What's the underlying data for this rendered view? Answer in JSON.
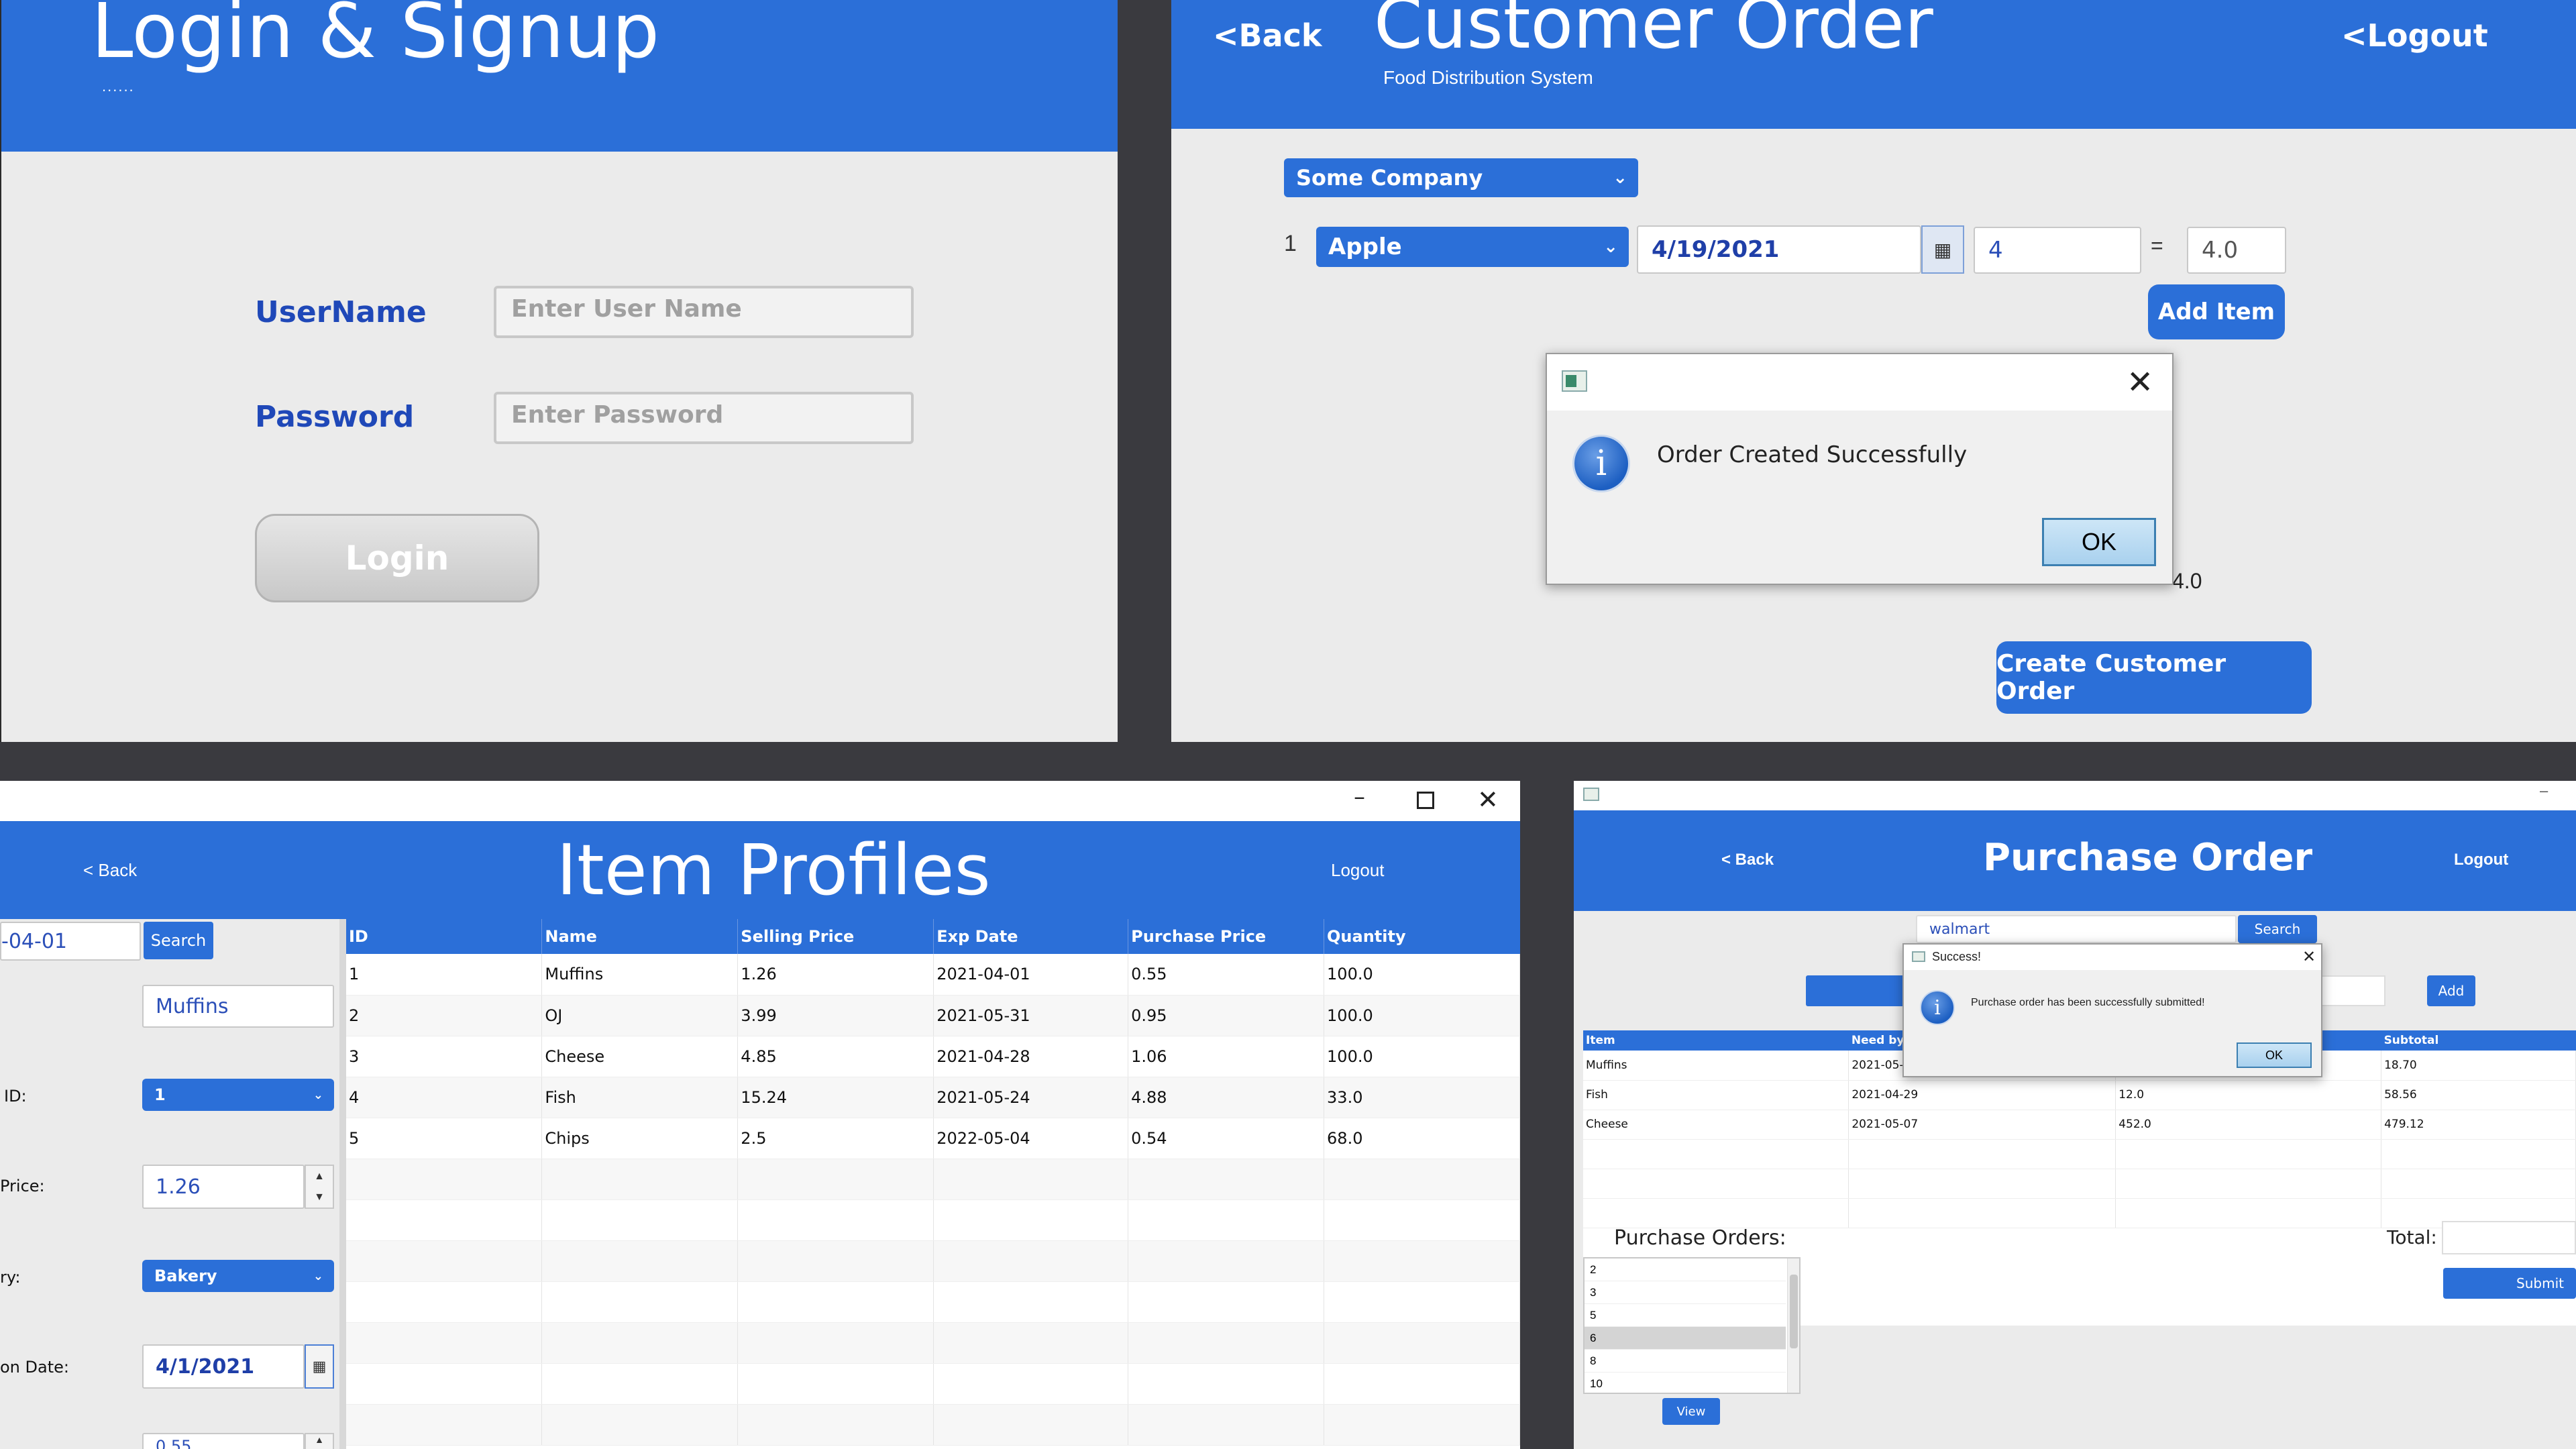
{
  "login": {
    "title": "Login & Signup",
    "subtitle": "......",
    "username_label": "UserName",
    "username_placeholder": "Enter User Name",
    "password_label": "Password",
    "password_placeholder": "Enter Password",
    "login_button": "Login"
  },
  "customer_order": {
    "back": "<Back",
    "title": "Customer Order",
    "subtitle": "Food Distribution System",
    "logout": "<Logout",
    "company_select": "Some Company",
    "row_number": "1",
    "item_select": "Apple",
    "date": "4/19/2021",
    "quantity": "4",
    "equals": "=",
    "line_total": "4.0",
    "add_item": "Add Item",
    "behind_total": "4.0",
    "create_button": "Create Customer Order",
    "dialog": {
      "message": "Order Created Successfully",
      "ok": "OK"
    }
  },
  "item_profiles": {
    "title": "Item Profiles",
    "back": "< Back",
    "logout": "Logout",
    "search_value": "-04-01",
    "search_button": "Search",
    "name_value": "Muffins",
    "id_label": "ID:",
    "id_value": "1",
    "price_label": "Price:",
    "price_value": "1.26",
    "category_label": "ry:",
    "category_value": "Bakery",
    "date_label": "on Date:",
    "date_value": "4/1/2021",
    "bottom_partial": "0.55",
    "columns": [
      "ID",
      "Name",
      "Selling Price",
      "Exp Date",
      "Purchase Price",
      "Quantity"
    ],
    "rows": [
      [
        "1",
        "Muffins",
        "1.26",
        "2021-04-01",
        "0.55",
        "100.0"
      ],
      [
        "2",
        "OJ",
        "3.99",
        "2021-05-31",
        "0.95",
        "100.0"
      ],
      [
        "3",
        "Cheese",
        "4.85",
        "2021-04-28",
        "1.06",
        "100.0"
      ],
      [
        "4",
        "Fish",
        "15.24",
        "2021-05-24",
        "4.88",
        "33.0"
      ],
      [
        "5",
        "Chips",
        "2.5",
        "2022-05-04",
        "0.54",
        "68.0"
      ]
    ]
  },
  "purchase_order": {
    "back": "< Back",
    "title": "Purchase Order",
    "logout": "Logout",
    "search_value": "walmart",
    "search_button": "Search",
    "add_button": "Add",
    "columns": [
      "Item",
      "Need by",
      "",
      "Subtotal"
    ],
    "rows": [
      [
        "Muffins",
        "2021-05-",
        "",
        "18.70"
      ],
      [
        "Fish",
        "2021-04-29",
        "12.0",
        "58.56"
      ],
      [
        "Cheese",
        "2021-05-07",
        "452.0",
        "479.12"
      ]
    ],
    "orders_label": "Purchase Orders:",
    "orders": [
      "2",
      "3",
      "5",
      "6",
      "8",
      "10"
    ],
    "view_button": "View",
    "total_label": "Total:",
    "submit_button": "Submit",
    "dialog": {
      "title": "Success!",
      "message": "Purchase order has been successfully submitted!",
      "ok": "OK"
    }
  }
}
